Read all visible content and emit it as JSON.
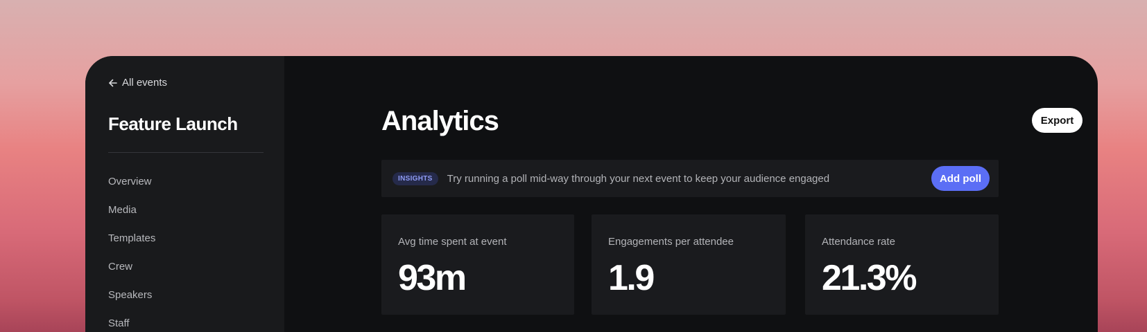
{
  "sidebar": {
    "back_label": "All events",
    "event_title": "Feature Launch",
    "nav": [
      {
        "label": "Overview"
      },
      {
        "label": "Media"
      },
      {
        "label": "Templates"
      },
      {
        "label": "Crew"
      },
      {
        "label": "Speakers"
      },
      {
        "label": "Staff"
      }
    ]
  },
  "main": {
    "title": "Analytics",
    "export_label": "Export",
    "insights": {
      "badge": "INSIGHTS",
      "text": "Try running a poll mid-way through your next event to keep your audience engaged",
      "action_label": "Add poll"
    },
    "stats": [
      {
        "label": "Avg time spent at event",
        "value": "93m"
      },
      {
        "label": "Engagements per attendee",
        "value": "1.9"
      },
      {
        "label": "Attendance rate",
        "value": "21.3%"
      }
    ]
  },
  "colors": {
    "accent": "#5b6ef5",
    "window_bg": "#0f1012",
    "sidebar_bg": "#191a1c",
    "card_bg": "#1a1b1e"
  },
  "icons": {
    "back": "arrow-left-icon"
  }
}
